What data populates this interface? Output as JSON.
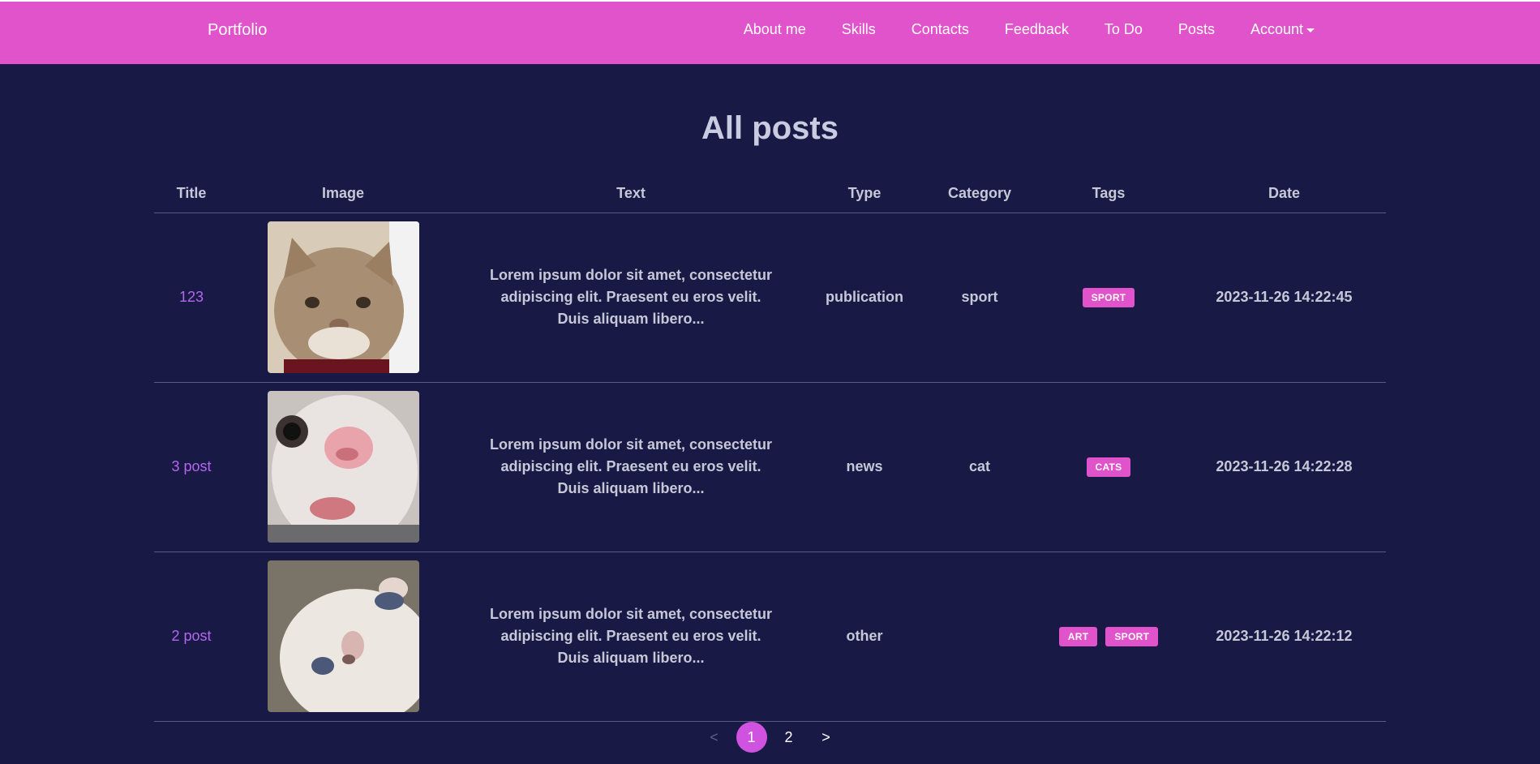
{
  "navbar": {
    "brand": "Portfolio",
    "links": [
      "About me",
      "Skills",
      "Contacts",
      "Feedback",
      "To Do",
      "Posts",
      "Account"
    ]
  },
  "page": {
    "title": "All posts"
  },
  "table": {
    "headers": [
      "Title",
      "Image",
      "Text",
      "Type",
      "Category",
      "Tags",
      "Date"
    ],
    "rows": [
      {
        "title": "123",
        "text": "Lorem ipsum dolor sit amet, consectetur adipiscing elit. Praesent eu eros velit. Duis aliquam libero...",
        "type": "publication",
        "category": "sport",
        "tags": [
          "SPORT"
        ],
        "date": "2023-11-26 14:22:45"
      },
      {
        "title": "3 post",
        "text": "Lorem ipsum dolor sit amet, consectetur adipiscing elit. Praesent eu eros velit. Duis aliquam libero...",
        "type": "news",
        "category": "cat",
        "tags": [
          "CATS"
        ],
        "date": "2023-11-26 14:22:28"
      },
      {
        "title": "2 post",
        "text": "Lorem ipsum dolor sit amet, consectetur adipiscing elit. Praesent eu eros velit. Duis aliquam libero...",
        "type": "other",
        "category": "",
        "tags": [
          "ART",
          "SPORT"
        ],
        "date": "2023-11-26 14:22:12"
      }
    ]
  },
  "pagination": {
    "prev": "<",
    "pages": [
      "1",
      "2"
    ],
    "current": "1",
    "next": ">"
  },
  "colors": {
    "navbar": "#e053cb",
    "background": "#181a45",
    "link": "#b566f0",
    "tag": "#e053cb"
  }
}
